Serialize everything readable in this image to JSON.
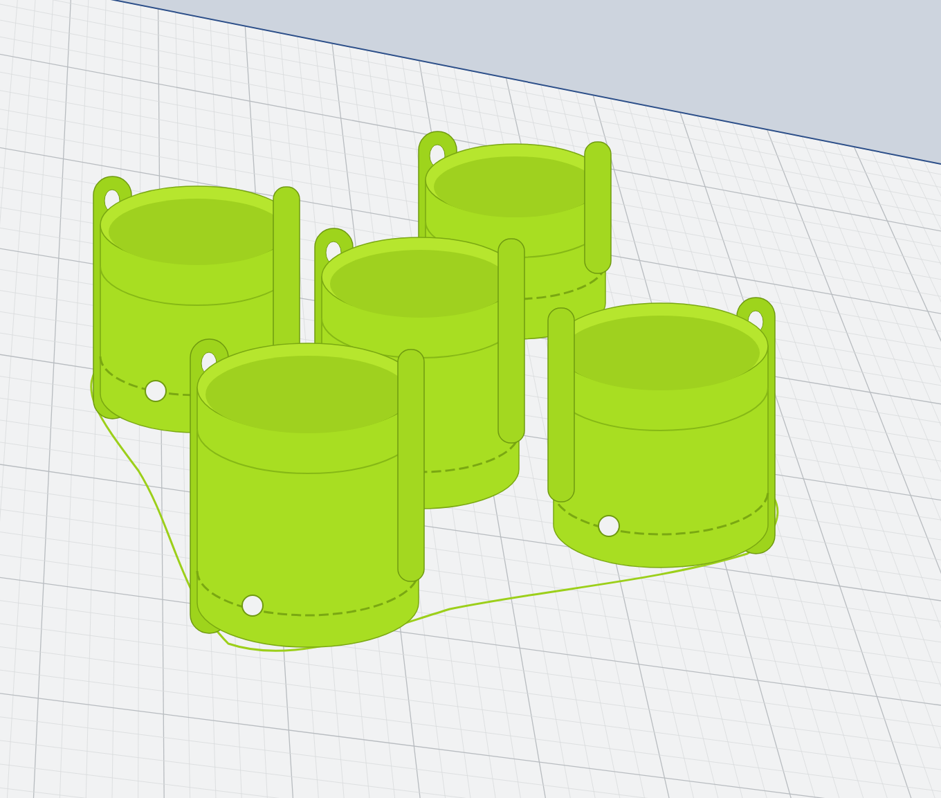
{
  "viewport": {
    "skirt_visible": true,
    "models": [
      {
        "kind": "cup"
      },
      {
        "kind": "cup"
      },
      {
        "kind": "cup"
      },
      {
        "kind": "cup"
      },
      {
        "kind": "cup"
      }
    ]
  }
}
